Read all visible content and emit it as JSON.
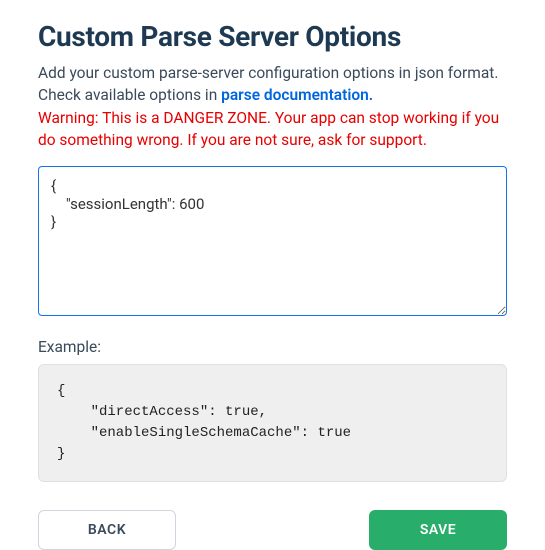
{
  "header": {
    "title": "Custom Parse Server Options"
  },
  "description": {
    "text_part1": "Add your custom parse-server configuration options in json format. Check available options in ",
    "link_text": "parse documentation."
  },
  "warning_text": "Warning: This is a DANGER ZONE. Your app can stop working if you do something wrong. If you are not sure, ask for support.",
  "config_input_value": "{\n    \"sessionLength\": 600\n}",
  "example": {
    "label": "Example:",
    "code": "{\n    \"directAccess\": true,\n    \"enableSingleSchemaCache\": true\n}"
  },
  "buttons": {
    "back_label": "BACK",
    "save_label": "SAVE"
  }
}
